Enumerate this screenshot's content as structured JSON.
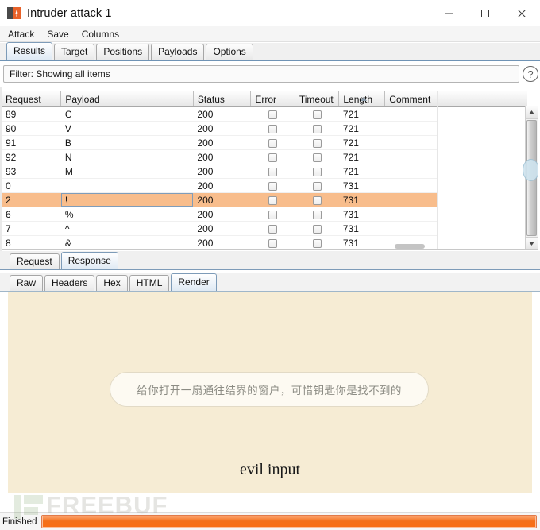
{
  "window": {
    "title": "Intruder attack 1",
    "icon": "burp-suite-icon",
    "controls": {
      "minimize": "minimize-icon",
      "maximize": "maximize-icon",
      "close": "close-icon"
    }
  },
  "menubar": {
    "items": [
      "Attack",
      "Save",
      "Columns"
    ]
  },
  "tabs": {
    "items": [
      "Results",
      "Target",
      "Positions",
      "Payloads",
      "Options"
    ],
    "active": "Results"
  },
  "filter": {
    "text": "Filter: Showing all items",
    "help_label": "?"
  },
  "table": {
    "columns": [
      "Request",
      "Payload",
      "Status",
      "Error",
      "Timeout",
      "Length",
      "Comment"
    ],
    "sort_column": "Length",
    "sort_direction": "asc",
    "rows": [
      {
        "request": "89",
        "payload": "C",
        "status": "200",
        "error": false,
        "timeout": false,
        "length": "721",
        "comment": "",
        "selected": false
      },
      {
        "request": "90",
        "payload": "V",
        "status": "200",
        "error": false,
        "timeout": false,
        "length": "721",
        "comment": "",
        "selected": false
      },
      {
        "request": "91",
        "payload": "B",
        "status": "200",
        "error": false,
        "timeout": false,
        "length": "721",
        "comment": "",
        "selected": false
      },
      {
        "request": "92",
        "payload": "N",
        "status": "200",
        "error": false,
        "timeout": false,
        "length": "721",
        "comment": "",
        "selected": false
      },
      {
        "request": "93",
        "payload": "M",
        "status": "200",
        "error": false,
        "timeout": false,
        "length": "721",
        "comment": "",
        "selected": false
      },
      {
        "request": "0",
        "payload": "",
        "status": "200",
        "error": false,
        "timeout": false,
        "length": "731",
        "comment": "",
        "selected": false
      },
      {
        "request": "2",
        "payload": "!",
        "status": "200",
        "error": false,
        "timeout": false,
        "length": "731",
        "comment": "",
        "selected": true
      },
      {
        "request": "6",
        "payload": "%",
        "status": "200",
        "error": false,
        "timeout": false,
        "length": "731",
        "comment": "",
        "selected": false
      },
      {
        "request": "7",
        "payload": "^",
        "status": "200",
        "error": false,
        "timeout": false,
        "length": "731",
        "comment": "",
        "selected": false
      },
      {
        "request": "8",
        "payload": "&",
        "status": "200",
        "error": false,
        "timeout": false,
        "length": "731",
        "comment": "",
        "selected": false
      }
    ]
  },
  "message_tabs": {
    "items": [
      "Request",
      "Response"
    ],
    "active": "Response"
  },
  "view_tabs": {
    "items": [
      "Raw",
      "Headers",
      "Hex",
      "HTML",
      "Render"
    ],
    "active": "Render"
  },
  "render": {
    "bubble_text": "给你打开一扇通往结界的窗户，可惜钥匙你是找不到的",
    "heading_text": "evil input",
    "background_color": "#f6ecd4"
  },
  "watermark": {
    "text": "FREEBUF"
  },
  "status": {
    "label": "Finished",
    "progress_percent": 100,
    "accent_color": "#f4701a"
  }
}
